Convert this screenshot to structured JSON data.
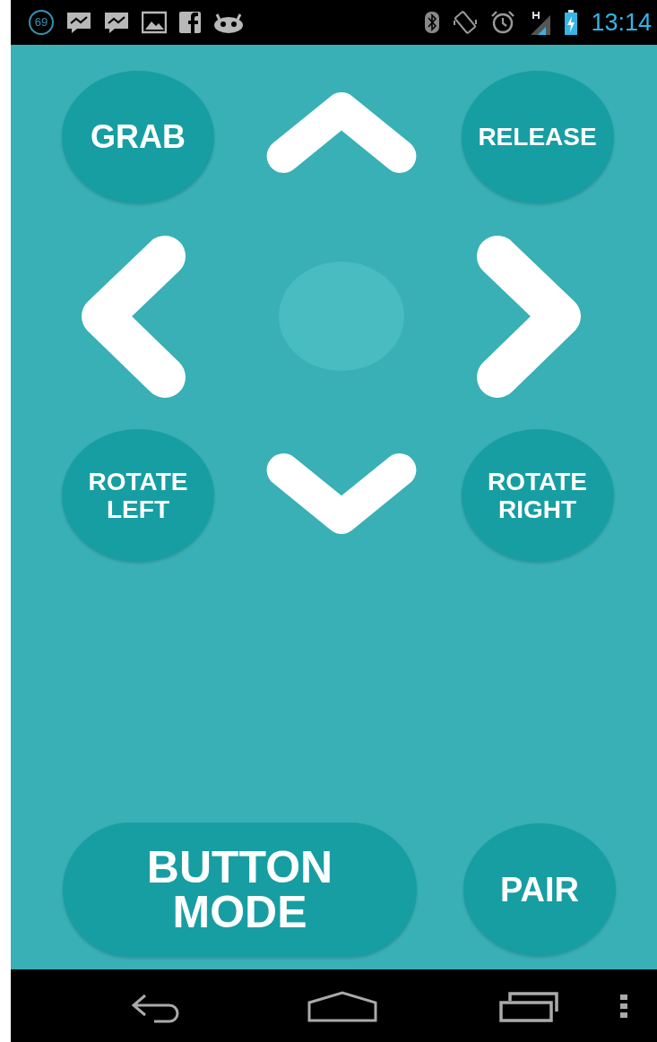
{
  "status_bar": {
    "notification_count": "69",
    "time": "13:14"
  },
  "pad_buttons": [
    {
      "label": "GRAB",
      "kind": "circle"
    },
    {
      "label": "RELEASE",
      "kind": "circle"
    },
    {
      "label": "ROTATE LEFT",
      "kind": "circle"
    },
    {
      "label": "ROTATE RIGHT",
      "kind": "circle"
    }
  ],
  "bottom_buttons": [
    {
      "label": "BUTTON MODE",
      "kind": "pill"
    },
    {
      "label": "PAIR",
      "kind": "circle"
    }
  ]
}
